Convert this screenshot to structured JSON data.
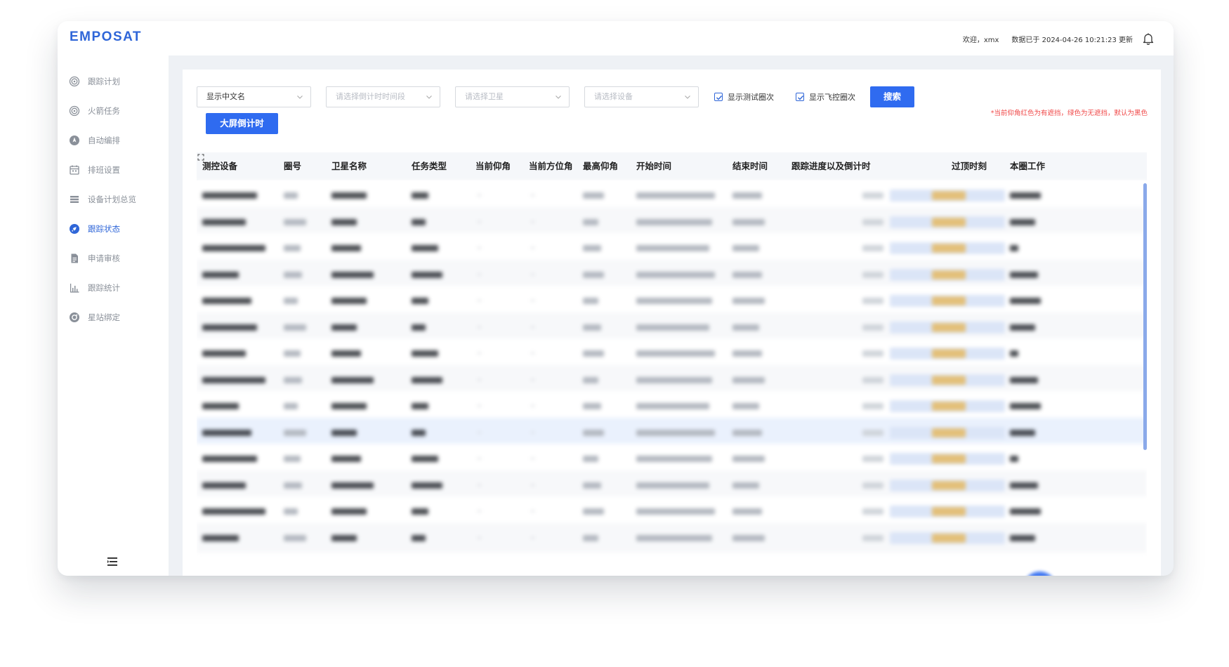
{
  "brand": {
    "logo": "EMPOSAT",
    "accent": "#2f66d8"
  },
  "header": {
    "welcome": "欢迎，xmx",
    "updated": "数据已于 2024-04-26 10:21:23 更新"
  },
  "sidebar": {
    "items": [
      {
        "label": "跟踪计划",
        "icon": "target-icon",
        "active": false
      },
      {
        "label": "火箭任务",
        "icon": "target-icon",
        "active": false
      },
      {
        "label": "自动编排",
        "icon": "compass-icon",
        "active": false
      },
      {
        "label": "排班设置",
        "icon": "calendar-icon",
        "active": false
      },
      {
        "label": "设备计划总览",
        "icon": "list-icon",
        "active": false
      },
      {
        "label": "跟踪状态",
        "icon": "rocket-icon",
        "active": true
      },
      {
        "label": "申请审核",
        "icon": "document-icon",
        "active": false
      },
      {
        "label": "跟踪统计",
        "icon": "bar-chart-icon",
        "active": false
      },
      {
        "label": "星站绑定",
        "icon": "link-icon",
        "active": false
      }
    ],
    "collapse_icon": "menu-collapse-icon"
  },
  "filters": {
    "language": "显示中文名",
    "countdown_placeholder": "请选择倒计时时间段",
    "satellite_placeholder": "请选择卫星",
    "device_placeholder": "请选择设备",
    "show_test": "显示测试圈次",
    "show_flight": "显示飞控圈次",
    "search": "搜索",
    "big_screen": "大屏倒计时",
    "note": "*当前仰角红色为有遮挡，绿色为无遮挡，默认为黑色"
  },
  "table": {
    "columns": [
      "测控设备",
      "圈号",
      "卫星名称",
      "任务类型",
      "当前仰角",
      "当前方位角",
      "最高仰角",
      "开始时间",
      "结束时间",
      "跟踪进度以及倒计时",
      "过顶时刻",
      "本圈工作"
    ],
    "highlighted_row": 9
  }
}
